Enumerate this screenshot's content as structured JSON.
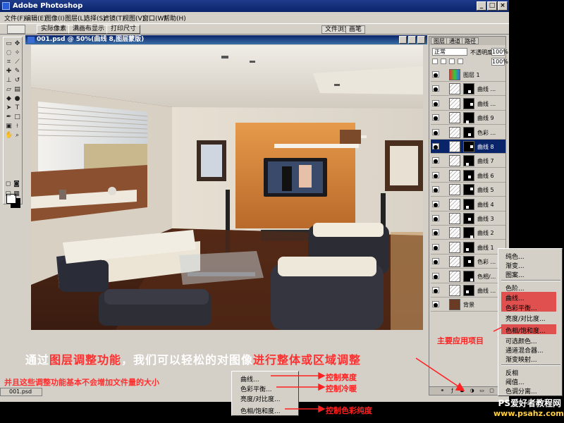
{
  "app": {
    "title": "Adobe Photoshop"
  },
  "window_buttons": [
    "_",
    "□",
    "×"
  ],
  "menu": [
    "文件(F)",
    "编辑(E)",
    "图像(I)",
    "图层(L)",
    "选择(S)",
    "滤镜(T)",
    "视图(V)",
    "窗口(W)",
    "帮助(H)"
  ],
  "options": {
    "buttons": [
      "实际像素",
      "满画布显示",
      "打印尺寸"
    ],
    "panel_tabs": [
      "文件浏览",
      "画笔"
    ]
  },
  "document": {
    "title": "001.psd @ 50%(曲线 8,图层蒙版)"
  },
  "layers_panel": {
    "tabs": [
      "图层",
      "通道",
      "路径"
    ],
    "blend_mode": "正常",
    "opacity_label": "不透明度:",
    "opacity": "100%",
    "fill": "100%",
    "layers": [
      {
        "name": "图层 1",
        "type": "pixel",
        "selected": false
      },
      {
        "name": "曲线 ...",
        "type": "adj",
        "selected": false
      },
      {
        "name": "曲线 ...",
        "type": "adj",
        "selected": false
      },
      {
        "name": "曲线 9",
        "type": "adj",
        "selected": false
      },
      {
        "name": "色彩 ...",
        "type": "adj",
        "selected": false
      },
      {
        "name": "曲线 8",
        "type": "adj",
        "selected": true
      },
      {
        "name": "曲线 7",
        "type": "adj",
        "selected": false
      },
      {
        "name": "曲线 6",
        "type": "adj",
        "selected": false
      },
      {
        "name": "曲线 5",
        "type": "adj",
        "selected": false
      },
      {
        "name": "曲线 4",
        "type": "adj",
        "selected": false
      },
      {
        "name": "曲线 3",
        "type": "adj",
        "selected": false
      },
      {
        "name": "曲线 2",
        "type": "adj",
        "selected": false
      },
      {
        "name": "曲线 1",
        "type": "adj",
        "selected": false
      },
      {
        "name": "色彩 ...",
        "type": "adj",
        "selected": false
      },
      {
        "name": "色相/...",
        "type": "adj",
        "selected": false
      },
      {
        "name": "曲线 ...",
        "type": "adj",
        "selected": false
      },
      {
        "name": "背景",
        "type": "bg",
        "selected": false
      }
    ]
  },
  "adjustment_menu": {
    "items": [
      "纯色...",
      "渐变...",
      "图案...",
      "色阶...",
      "曲线...",
      "色彩平衡...",
      "亮度/对比度...",
      "色相/饱和度...",
      "可选颜色...",
      "通道混合器...",
      "渐变映射...",
      "反相",
      "阈值...",
      "色调分离..."
    ],
    "highlighted": [
      "曲线...",
      "色彩平衡...",
      "色相/饱和度..."
    ]
  },
  "small_menu": {
    "items": [
      "曲线...",
      "色彩平衡...",
      "亮度/对比度...",
      "色相/饱和度..."
    ]
  },
  "annotations": {
    "main_part1": "通过",
    "main_red1": "图层调整功能",
    "main_part2": "，我们可以轻松的对图像",
    "main_red2": "进行整体或区域调整",
    "sub": "并且这些调整功能基本不会增加文件量的大小",
    "brightness": "控制亮度",
    "coolwarm": "控制冷暖",
    "saturation": "控制色彩纯度",
    "main_items": "主要应用项目"
  },
  "taskbar": {
    "doc_tab": "001.psd"
  },
  "watermark": {
    "line1": "PS爱好者教程网",
    "url": "www.psahz.com"
  },
  "colors": {
    "accent_red": "#ff2020",
    "titlebar_blue": "#0a246a"
  }
}
